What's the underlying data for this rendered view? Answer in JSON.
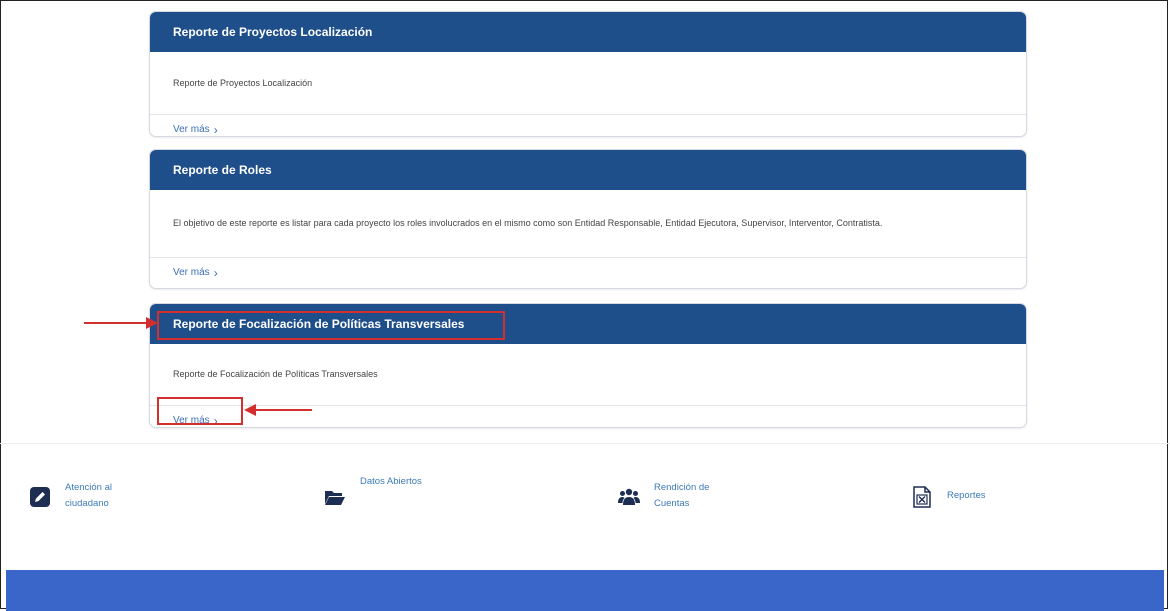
{
  "cards": [
    {
      "title": "Reporte de Proyectos Localización",
      "description": "Reporte de Proyectos Localización",
      "link": "Ver más"
    },
    {
      "title": "Reporte de Roles",
      "description": "El objetivo de este reporte es listar para cada proyecto los roles involucrados en el mismo como son Entidad Responsable, Entidad Ejecutora, Supervisor, Interventor, Contratista.",
      "link": "Ver más"
    },
    {
      "title": "Reporte de Focalización de Políticas Transversales",
      "description": "Reporte de Focalización de Políticas Transversales",
      "link": "Ver más"
    }
  ],
  "footer_links": [
    {
      "label": "Atención al ciudadano",
      "icon": "pencil-square-icon"
    },
    {
      "label": "Datos Abiertos",
      "icon": "folder-open-icon"
    },
    {
      "label": "Rendición de Cuentas",
      "icon": "users-icon"
    },
    {
      "label": "Reportes",
      "icon": "excel-file-icon"
    }
  ],
  "colors": {
    "header": "#1f4f8b",
    "link": "#3b6fb6",
    "annotation": "#d32f2f",
    "bottom_bar": "#3a66c9"
  }
}
